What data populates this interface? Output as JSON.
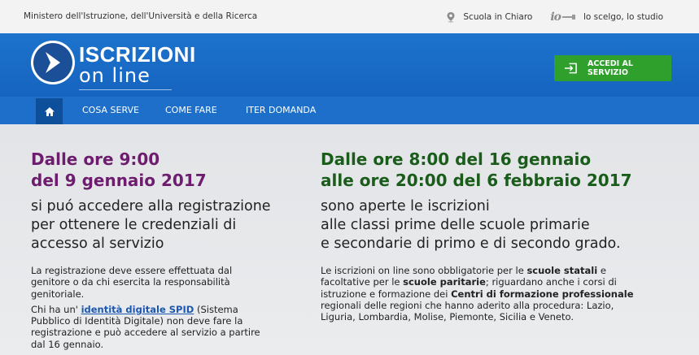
{
  "topbar": {
    "ministry": "Ministero dell'Istruzione, dell'Università e della Ricerca",
    "scuola_link": "Scuola in Chiaro",
    "io_logo": "io",
    "slogan_link": "lo scelgo, lo studio"
  },
  "header": {
    "brand_line1": "ISCRIZIONI",
    "brand_line2": "on line",
    "accedi_label": "ACCEDI AL SERVIZIO"
  },
  "nav": {
    "items": [
      {
        "label": "COSA SERVE"
      },
      {
        "label": "COME FARE"
      },
      {
        "label": "ITER DOMANDA"
      }
    ]
  },
  "left": {
    "heading1": "Dalle ore 9:00",
    "heading2": "del 9 gennaio 2017",
    "lead1": "si puó accedere alla registrazione",
    "lead2": "per ottenere le credenziali di",
    "lead3": "accesso al servizio",
    "p1_l1": "La registrazione deve essere effettuata dal",
    "p1_l2": "genitore o da chi esercita la responsabilità",
    "p1_l3": "genitoriale.",
    "p2_prefix": "Chi ha un' ",
    "p2_link": "identità digitale SPID",
    "p2_l1_suffix": " (Sistema",
    "p2_l2": "Pubblico di Identità Digitale) non deve fare la",
    "p2_l3": "registrazione e può accedere al servizio a partire",
    "p2_l4": "dal 16 gennaio."
  },
  "right": {
    "heading1": "Dalle ore 8:00 del 16 gennaio",
    "heading2": "alle ore 20:00 del 6 febbraio 2017",
    "lead1": "sono aperte le iscrizioni",
    "lead2": "alle classi prime delle scuole primarie",
    "lead3": "e secondarie di primo e di secondo grado.",
    "l1_a": "Le iscrizioni on line sono obbligatorie per le ",
    "l1_b": "scuole statali",
    "l1_c": " e",
    "l2_a": "facoltative per le ",
    "l2_b": "scuole paritarie",
    "l2_c": "; riguardano anche i corsi di",
    "l3_a": "istruzione e formazione dei ",
    "l3_b": "Centri di formazione professionale",
    "l4": "regionali delle regioni che hanno aderito alla procedura: Lazio,",
    "l5": "Liguria, Lombardia, Molise, Piemonte, Sicilia e Veneto."
  },
  "colors": {
    "header_blue": "#1564c0",
    "nav_blue": "#1e6fca",
    "home_blue": "#0d4f9a",
    "accedi_green": "#2ea02b",
    "heading_purple": "#6e1d6e",
    "heading_green": "#1a5c1a",
    "spid_link": "#1b57b0"
  },
  "icons": [
    "location-pin-icon",
    "io-logo-icon",
    "iscrizioni-logo-icon",
    "login-icon",
    "home-icon"
  ]
}
